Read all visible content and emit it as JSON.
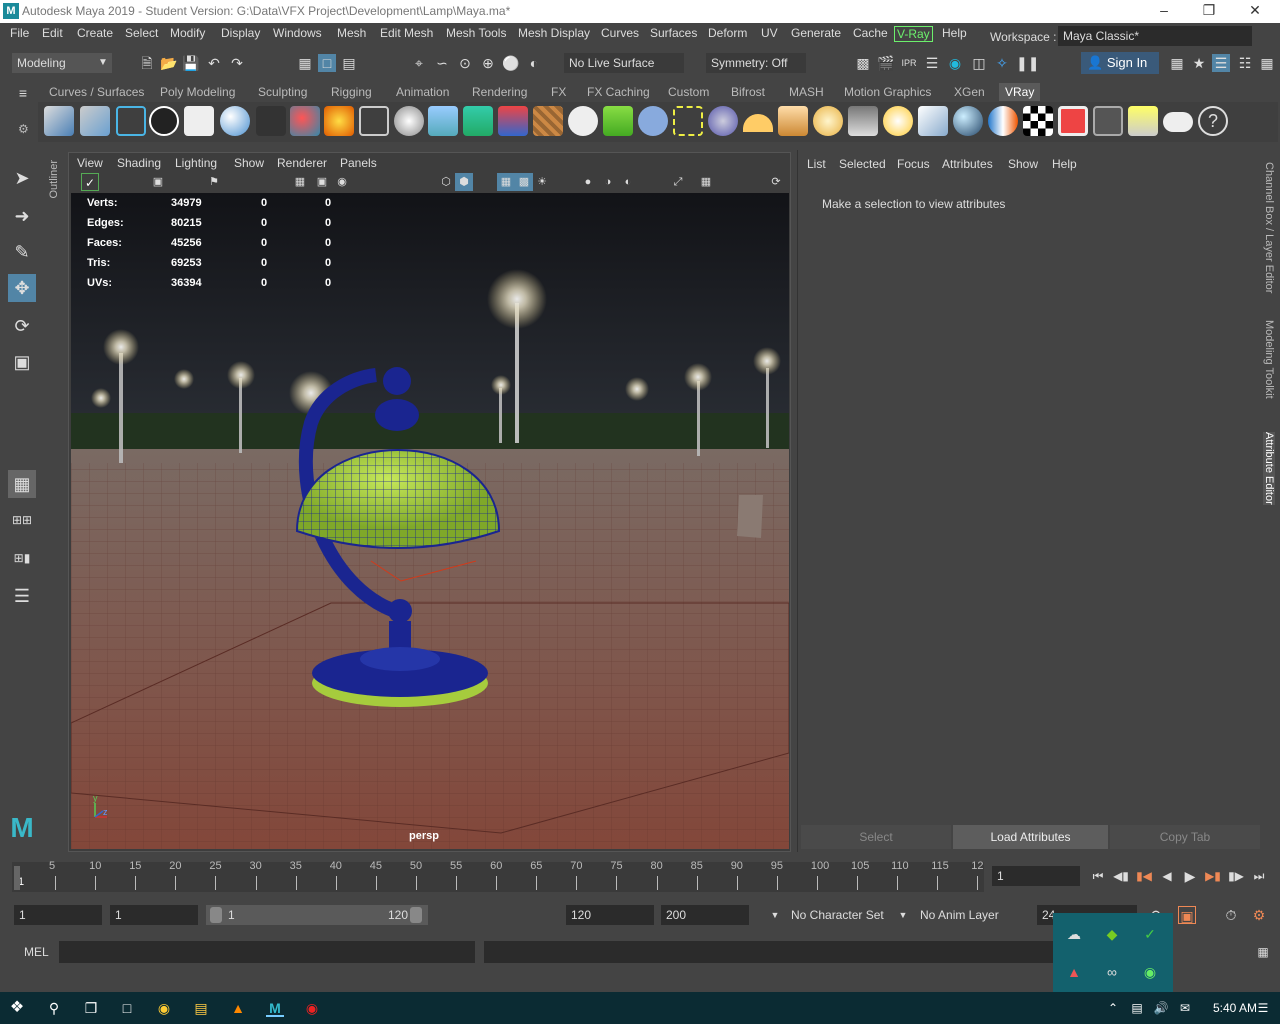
{
  "window": {
    "title": "Autodesk Maya 2019 - Student Version: G:\\Data\\VFX Project\\Development\\Lamp\\Maya.ma*"
  },
  "menu": [
    "File",
    "Edit",
    "Create",
    "Select",
    "Modify",
    "Display",
    "Windows",
    "Mesh",
    "Edit Mesh",
    "Mesh Tools",
    "Mesh Display",
    "Curves",
    "Surfaces",
    "Deform",
    "UV",
    "Generate",
    "Cache",
    "V-Ray",
    "Help"
  ],
  "workspace": {
    "label": "Workspace :",
    "value": "Maya Classic*"
  },
  "status": {
    "menuset": "Modeling",
    "live_surface": "No Live Surface",
    "symmetry": "Symmetry: Off",
    "sign_in": "Sign In"
  },
  "shelf_tabs": [
    "Curves / Surfaces",
    "Poly Modeling",
    "Sculpting",
    "Rigging",
    "Animation",
    "Rendering",
    "FX",
    "FX Caching",
    "Custom",
    "Bifrost",
    "MASH",
    "Motion Graphics",
    "XGen",
    "VRay"
  ],
  "shelf_active": "VRay",
  "outliner": {
    "label": "Outliner"
  },
  "viewport": {
    "menus": [
      "View",
      "Shading",
      "Lighting",
      "Show",
      "Renderer",
      "Panels"
    ],
    "camera": "persp",
    "hud": [
      {
        "label": "Verts:",
        "a": "34979",
        "b": "0",
        "c": "0"
      },
      {
        "label": "Edges:",
        "a": "80215",
        "b": "0",
        "c": "0"
      },
      {
        "label": "Faces:",
        "a": "45256",
        "b": "0",
        "c": "0"
      },
      {
        "label": "Tris:",
        "a": "69253",
        "b": "0",
        "c": "0"
      },
      {
        "label": "UVs:",
        "a": "36394",
        "b": "0",
        "c": "0"
      }
    ],
    "axis": {
      "y": "y",
      "z": "z"
    }
  },
  "attr_editor": {
    "menus": [
      "List",
      "Selected",
      "Focus",
      "Attributes",
      "Show",
      "Help"
    ],
    "message": "Make a selection to view attributes",
    "buttons": {
      "select": "Select",
      "load": "Load Attributes",
      "copy": "Copy Tab"
    }
  },
  "side_tabs": [
    "Channel Box / Layer Editor",
    "Modeling Toolkit",
    "Attribute Editor"
  ],
  "timeline": {
    "ticks": [
      "5",
      "10",
      "15",
      "20",
      "25",
      "30",
      "35",
      "40",
      "45",
      "50",
      "55",
      "60",
      "65",
      "70",
      "75",
      "80",
      "85",
      "90",
      "95",
      "100",
      "105",
      "110",
      "115",
      "12"
    ],
    "start_label": "1",
    "current_frame": "1"
  },
  "range": {
    "start": "1",
    "playback_start": "1",
    "slider_start": "1",
    "slider_end": "120",
    "playback_end": "120",
    "end": "200",
    "char_set": "No Character Set",
    "anim_layer": "No Anim Layer",
    "fps": "24"
  },
  "cmd": {
    "lang": "MEL"
  },
  "taskbar": {
    "clock": "5:40 AM"
  }
}
